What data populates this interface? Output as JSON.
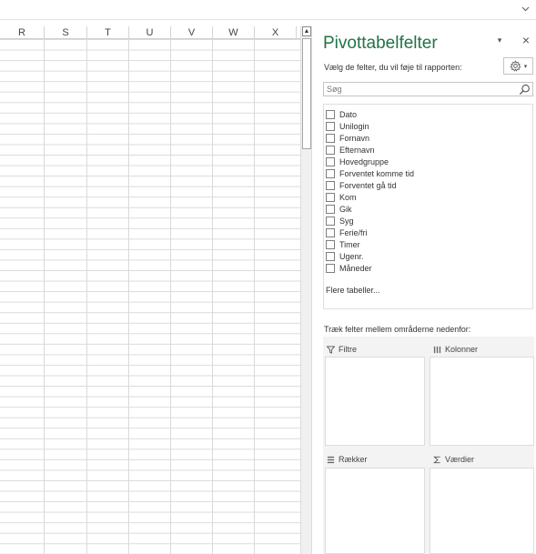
{
  "ribbon": {
    "collapse_icon": "chevron-down"
  },
  "columns": [
    "R",
    "S",
    "T",
    "U",
    "V",
    "W",
    "X"
  ],
  "scrollbar": {
    "up_arrow": "▲"
  },
  "pivot_pane": {
    "title": "Pivottabelfelter",
    "dropdown_glyph": "▾",
    "close_glyph": "×",
    "subtitle": "Vælg de felter, du vil føje til rapporten:",
    "tools_caret": "▾",
    "search": {
      "placeholder": "Søg",
      "value": ""
    },
    "fields": [
      {
        "label": "Dato",
        "checked": false
      },
      {
        "label": "Unilogin",
        "checked": false
      },
      {
        "label": "Fornavn",
        "checked": false
      },
      {
        "label": "Efternavn",
        "checked": false
      },
      {
        "label": "Hovedgruppe",
        "checked": false
      },
      {
        "label": "Forventet komme tid",
        "checked": false
      },
      {
        "label": "Forventet gå tid",
        "checked": false
      },
      {
        "label": "Kom",
        "checked": false
      },
      {
        "label": "Gik",
        "checked": false
      },
      {
        "label": "Syg",
        "checked": false
      },
      {
        "label": "Ferie/fri",
        "checked": false
      },
      {
        "label": "Timer",
        "checked": false
      },
      {
        "label": "Ugenr.",
        "checked": false
      },
      {
        "label": "Måneder",
        "checked": false
      }
    ],
    "more_tables": "Flere tabeller...",
    "areas_hint": "Træk felter mellem områderne nedenfor:",
    "areas": {
      "filters": {
        "label": "Filtre",
        "icon": "filter-icon"
      },
      "columns": {
        "label": "Kolonner",
        "icon": "columns-icon"
      },
      "rows": {
        "label": "Rækker",
        "icon": "rows-icon"
      },
      "values": {
        "label": "Værdier",
        "icon": "sigma-icon"
      }
    },
    "colors": {
      "title": "#217346",
      "border": "#dcdcdc"
    }
  }
}
